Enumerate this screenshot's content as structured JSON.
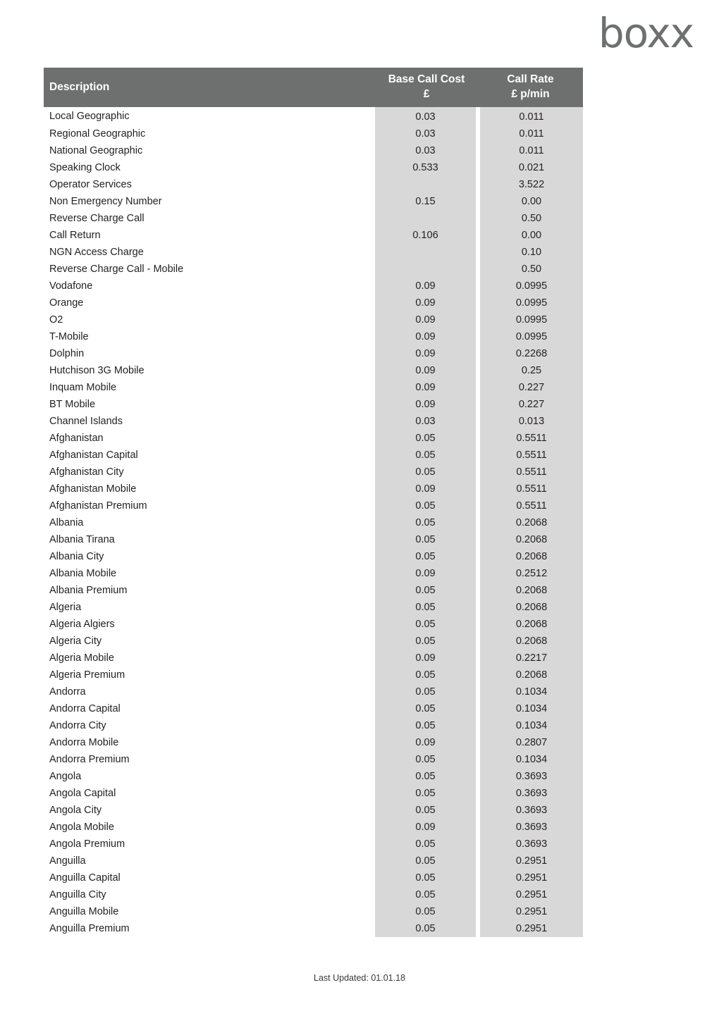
{
  "brand": {
    "logo_text": "boxx"
  },
  "table": {
    "headers": {
      "description": "Description",
      "base_call_cost_line1": "Base Call Cost",
      "base_call_cost_line2": "£",
      "call_rate_line1": "Call Rate",
      "call_rate_line2": "£ p/min"
    },
    "colors": {
      "header_background": "#6e7070",
      "header_text": "#ffffff",
      "value_cell_background": "#d8d8d8",
      "body_text": "#231f20",
      "logo": "#6e7070"
    },
    "rows": [
      {
        "description": "Local Geographic",
        "base_call_cost": "0.03",
        "call_rate": "0.011"
      },
      {
        "description": "Regional Geographic",
        "base_call_cost": "0.03",
        "call_rate": "0.011"
      },
      {
        "description": "National Geographic",
        "base_call_cost": "0.03",
        "call_rate": "0.011"
      },
      {
        "description": "Speaking Clock",
        "base_call_cost": "0.533",
        "call_rate": "0.021"
      },
      {
        "description": "Operator Services",
        "base_call_cost": "",
        "call_rate": "3.522"
      },
      {
        "description": "Non Emergency Number",
        "base_call_cost": "0.15",
        "call_rate": "0.00"
      },
      {
        "description": "Reverse Charge Call",
        "base_call_cost": "",
        "call_rate": "0.50"
      },
      {
        "description": "Call Return",
        "base_call_cost": "0.106",
        "call_rate": "0.00"
      },
      {
        "description": "NGN Access Charge",
        "base_call_cost": "",
        "call_rate": "0.10"
      },
      {
        "description": "Reverse Charge Call - Mobile",
        "base_call_cost": "",
        "call_rate": "0.50"
      },
      {
        "description": "Vodafone",
        "base_call_cost": "0.09",
        "call_rate": "0.0995"
      },
      {
        "description": "Orange",
        "base_call_cost": "0.09",
        "call_rate": "0.0995"
      },
      {
        "description": "O2",
        "base_call_cost": "0.09",
        "call_rate": "0.0995"
      },
      {
        "description": "T-Mobile",
        "base_call_cost": "0.09",
        "call_rate": "0.0995"
      },
      {
        "description": "Dolphin",
        "base_call_cost": "0.09",
        "call_rate": "0.2268"
      },
      {
        "description": "Hutchison 3G Mobile",
        "base_call_cost": "0.09",
        "call_rate": "0.25"
      },
      {
        "description": "Inquam Mobile",
        "base_call_cost": "0.09",
        "call_rate": "0.227"
      },
      {
        "description": "BT Mobile",
        "base_call_cost": "0.09",
        "call_rate": "0.227"
      },
      {
        "description": "Channel Islands",
        "base_call_cost": "0.03",
        "call_rate": "0.013"
      },
      {
        "description": "Afghanistan",
        "base_call_cost": "0.05",
        "call_rate": "0.5511"
      },
      {
        "description": "Afghanistan Capital",
        "base_call_cost": "0.05",
        "call_rate": "0.5511"
      },
      {
        "description": "Afghanistan City",
        "base_call_cost": "0.05",
        "call_rate": "0.5511"
      },
      {
        "description": "Afghanistan Mobile",
        "base_call_cost": "0.09",
        "call_rate": "0.5511"
      },
      {
        "description": "Afghanistan Premium",
        "base_call_cost": "0.05",
        "call_rate": "0.5511"
      },
      {
        "description": "Albania",
        "base_call_cost": "0.05",
        "call_rate": "0.2068"
      },
      {
        "description": "Albania Tirana",
        "base_call_cost": "0.05",
        "call_rate": "0.2068"
      },
      {
        "description": "Albania City",
        "base_call_cost": "0.05",
        "call_rate": "0.2068"
      },
      {
        "description": "Albania Mobile",
        "base_call_cost": "0.09",
        "call_rate": "0.2512"
      },
      {
        "description": "Albania Premium",
        "base_call_cost": "0.05",
        "call_rate": "0.2068"
      },
      {
        "description": "Algeria",
        "base_call_cost": "0.05",
        "call_rate": "0.2068"
      },
      {
        "description": "Algeria Algiers",
        "base_call_cost": "0.05",
        "call_rate": "0.2068"
      },
      {
        "description": "Algeria City",
        "base_call_cost": "0.05",
        "call_rate": "0.2068"
      },
      {
        "description": "Algeria Mobile",
        "base_call_cost": "0.09",
        "call_rate": "0.2217"
      },
      {
        "description": "Algeria Premium",
        "base_call_cost": "0.05",
        "call_rate": "0.2068"
      },
      {
        "description": "Andorra",
        "base_call_cost": "0.05",
        "call_rate": "0.1034"
      },
      {
        "description": "Andorra Capital",
        "base_call_cost": "0.05",
        "call_rate": "0.1034"
      },
      {
        "description": "Andorra City",
        "base_call_cost": "0.05",
        "call_rate": "0.1034"
      },
      {
        "description": "Andorra Mobile",
        "base_call_cost": "0.09",
        "call_rate": "0.2807"
      },
      {
        "description": "Andorra Premium",
        "base_call_cost": "0.05",
        "call_rate": "0.1034"
      },
      {
        "description": "Angola",
        "base_call_cost": "0.05",
        "call_rate": "0.3693"
      },
      {
        "description": "Angola Capital",
        "base_call_cost": "0.05",
        "call_rate": "0.3693"
      },
      {
        "description": "Angola City",
        "base_call_cost": "0.05",
        "call_rate": "0.3693"
      },
      {
        "description": "Angola Mobile",
        "base_call_cost": "0.09",
        "call_rate": "0.3693"
      },
      {
        "description": "Angola Premium",
        "base_call_cost": "0.05",
        "call_rate": "0.3693"
      },
      {
        "description": "Anguilla",
        "base_call_cost": "0.05",
        "call_rate": "0.2951"
      },
      {
        "description": "Anguilla Capital",
        "base_call_cost": "0.05",
        "call_rate": "0.2951"
      },
      {
        "description": "Anguilla City",
        "base_call_cost": "0.05",
        "call_rate": "0.2951"
      },
      {
        "description": "Anguilla Mobile",
        "base_call_cost": "0.05",
        "call_rate": "0.2951"
      },
      {
        "description": "Anguilla Premium",
        "base_call_cost": "0.05",
        "call_rate": "0.2951"
      }
    ]
  },
  "footer": {
    "last_updated": "Last Updated: 01.01.18"
  }
}
